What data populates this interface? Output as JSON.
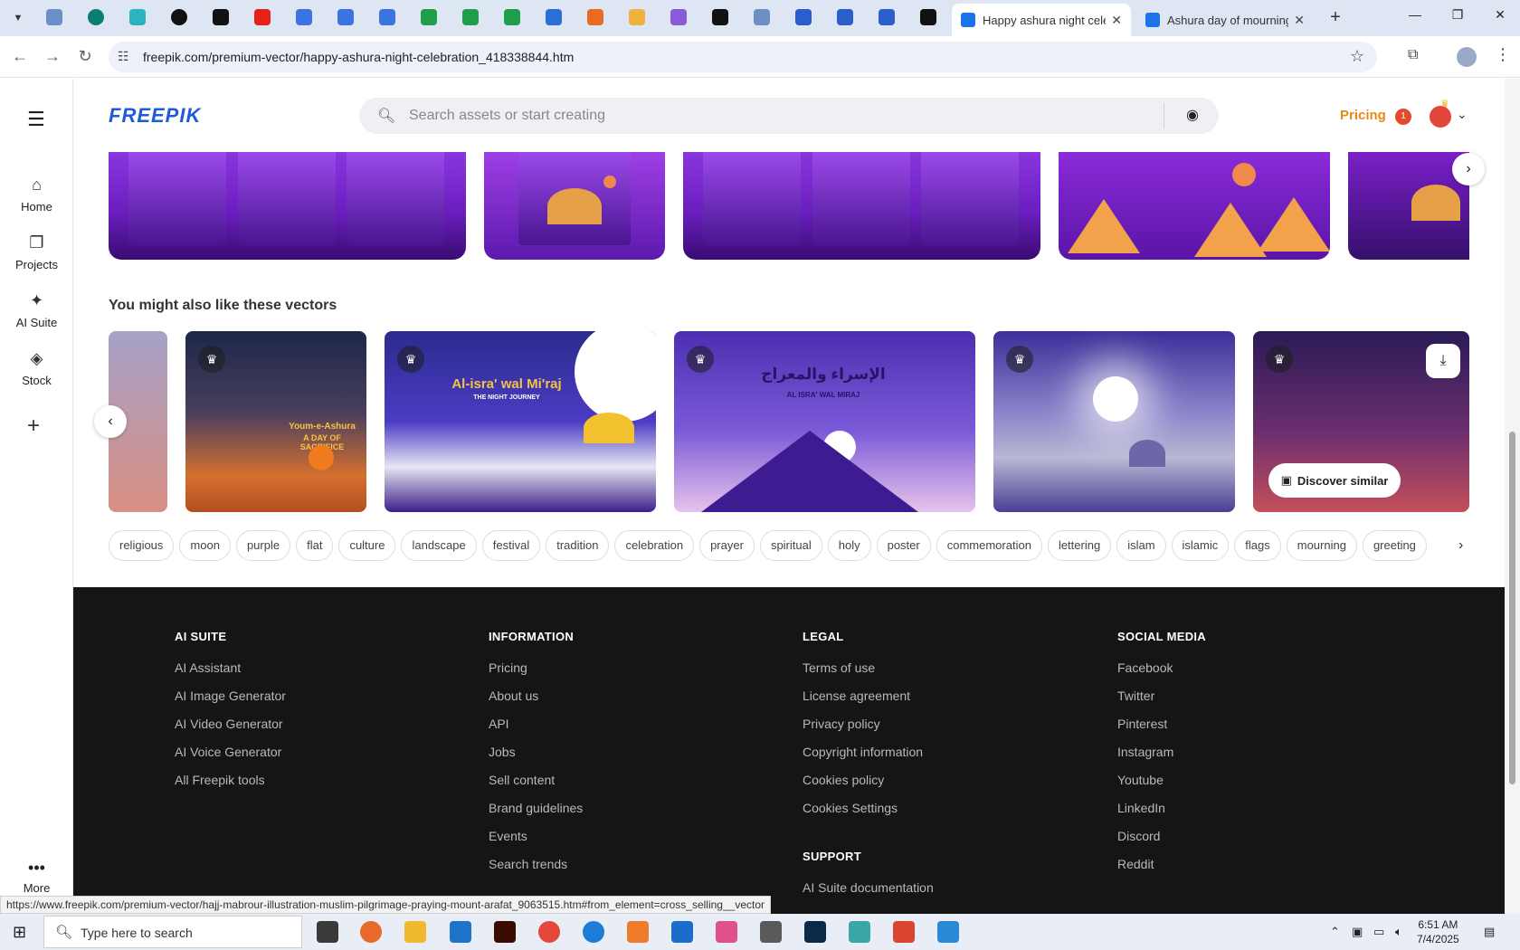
{
  "browser": {
    "tabs": [
      {
        "title": "Happy ashura night celeb",
        "active": true
      },
      {
        "title": "Ashura day of mourning",
        "active": false
      }
    ],
    "url": "freepik.com/premium-vector/happy-ashura-night-celebration_418338844.htm",
    "status_link": "https://www.freepik.com/premium-vector/hajj-mabrour-illustration-muslim-pilgrimage-praying-mount-arafat_9063515.htm#from_element=cross_selling__vector"
  },
  "sidebar": {
    "items": [
      {
        "label": "Home",
        "icon": "home-icon"
      },
      {
        "label": "Projects",
        "icon": "projects-icon"
      },
      {
        "label": "AI Suite",
        "icon": "sparkle-icon"
      },
      {
        "label": "Stock",
        "icon": "stock-icon"
      }
    ],
    "more_label": "More"
  },
  "header": {
    "logo": "FREEPIK",
    "search_placeholder": "Search assets or start creating",
    "pricing": "Pricing",
    "notification_count": "1"
  },
  "similar": {
    "title": "You might also like these vectors",
    "cards": [
      {
        "text_1": "Youm-e-Ashura",
        "text_2": "A DAY OF SACRIFICE"
      },
      {
        "text_1": "Al-isra' wal Mi'raj",
        "text_2": "THE NIGHT JOURNEY"
      },
      {
        "text_1": "الإسراء والمعراج",
        "text_2": "AL ISRA' WAL MIRAJ"
      }
    ],
    "discover_label": "Discover similar"
  },
  "tags": [
    "religious",
    "moon",
    "purple",
    "flat",
    "culture",
    "landscape",
    "festival",
    "tradition",
    "celebration",
    "prayer",
    "spiritual",
    "holy",
    "poster",
    "commemoration",
    "lettering",
    "islam",
    "islamic",
    "flags",
    "mourning",
    "greeting"
  ],
  "footer": {
    "ai_suite": {
      "heading": "AI SUITE",
      "links": [
        "AI Assistant",
        "AI Image Generator",
        "AI Video Generator",
        "AI Voice Generator",
        "All Freepik tools"
      ]
    },
    "information": {
      "heading": "INFORMATION",
      "links": [
        "Pricing",
        "About us",
        "API",
        "Jobs",
        "Sell content",
        "Brand guidelines",
        "Events",
        "Search trends"
      ]
    },
    "legal": {
      "heading": "LEGAL",
      "links": [
        "Terms of use",
        "License agreement",
        "Privacy policy",
        "Copyright information",
        "Cookies policy",
        "Cookies Settings"
      ]
    },
    "support": {
      "heading": "SUPPORT",
      "links": [
        "AI Suite documentation"
      ]
    },
    "social": {
      "heading": "SOCIAL MEDIA",
      "links": [
        "Facebook",
        "Twitter",
        "Pinterest",
        "Instagram",
        "Youtube",
        "LinkedIn",
        "Discord",
        "Reddit"
      ]
    }
  },
  "taskbar": {
    "search_placeholder": "Type here to search",
    "time": "6:51 AM",
    "date": "7/4/2025"
  },
  "colors": {
    "brand_blue": "#1d5bd8",
    "pricing_orange": "#e68a17",
    "footer_bg": "#151515"
  }
}
